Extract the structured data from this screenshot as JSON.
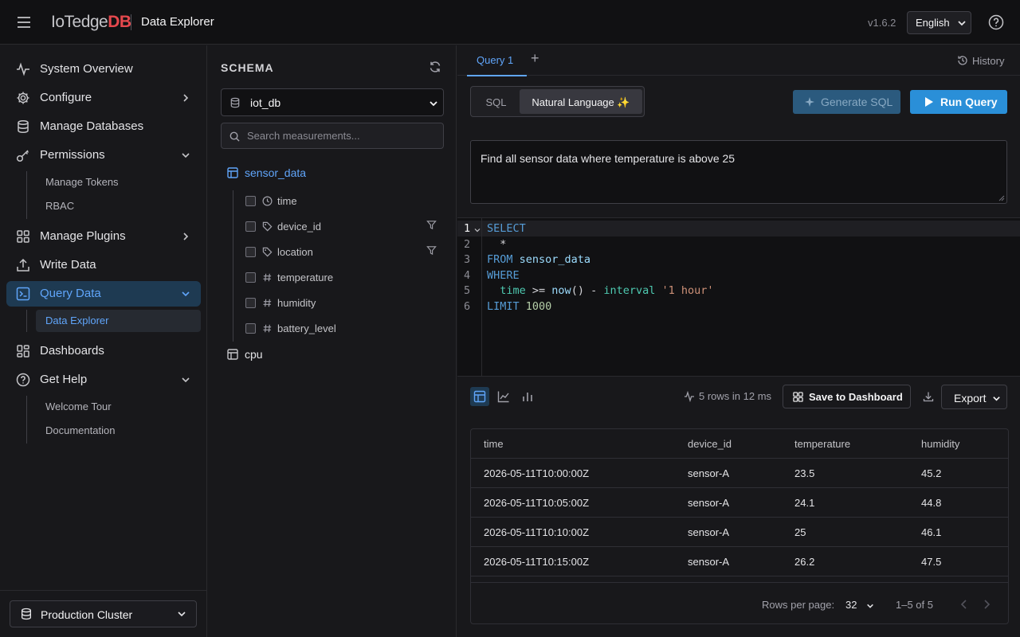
{
  "header": {
    "logo_main": "IoTedge",
    "logo_db": "DB",
    "title": "Data Explorer",
    "version": "v1.6.2",
    "language": "English"
  },
  "sidebar": {
    "items": {
      "overview": "System Overview",
      "configure": "Configure",
      "manage_databases": "Manage Databases",
      "permissions": "Permissions",
      "manage_tokens": "Manage Tokens",
      "rbac": "RBAC",
      "manage_plugins": "Manage Plugins",
      "write_data": "Write Data",
      "query_data": "Query Data",
      "data_explorer": "Data Explorer",
      "dashboards": "Dashboards",
      "get_help": "Get Help",
      "welcome_tour": "Welcome Tour",
      "documentation": "Documentation"
    },
    "cluster": "Production Cluster"
  },
  "schema": {
    "title": "SCHEMA",
    "database": "iot_db",
    "search_placeholder": "Search measurements...",
    "measurements": [
      "sensor_data",
      "cpu"
    ],
    "fields": [
      "time",
      "device_id",
      "location",
      "temperature",
      "humidity",
      "battery_level"
    ]
  },
  "query": {
    "tab_label": "Query 1",
    "add_tab": "+",
    "history_label": "History",
    "mode_sql": "SQL",
    "mode_nl": "Natural Language ✨",
    "generate_label": "Generate SQL",
    "run_label": "Run Query",
    "nl_text": "Find all sensor data where temperature is above 25",
    "line_numbers": [
      "1",
      "2",
      "3",
      "4",
      "5",
      "6"
    ]
  },
  "results": {
    "stats": "5 rows in 12 ms",
    "save_label": "Save to Dashboard",
    "export_label": "Export",
    "columns": [
      "time",
      "device_id",
      "temperature",
      "humidity"
    ],
    "rows": [
      [
        "2026-05-11T10:00:00Z",
        "sensor-A",
        "23.5",
        "45.2"
      ],
      [
        "2026-05-11T10:05:00Z",
        "sensor-A",
        "24.1",
        "44.8"
      ],
      [
        "2026-05-11T10:10:00Z",
        "sensor-A",
        "25",
        "46.1"
      ],
      [
        "2026-05-11T10:15:00Z",
        "sensor-A",
        "26.2",
        "47.5"
      ]
    ],
    "rows_per_page_label": "Rows per page:",
    "rows_per_page": "32",
    "page_info": "1–5 of 5"
  },
  "colors": {
    "accent": "#60a5fa",
    "primary_button": "#2a8fd8",
    "brand_red": "#e5484d"
  }
}
